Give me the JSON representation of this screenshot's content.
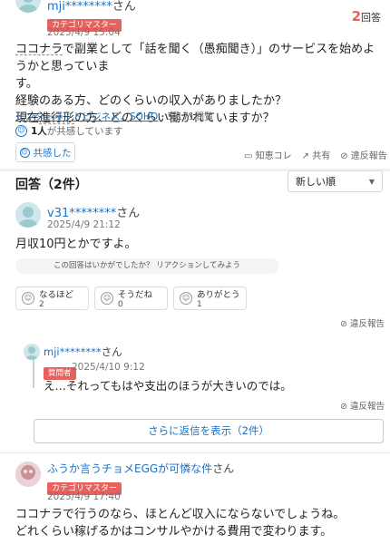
{
  "question": {
    "user": "mji********",
    "san": "さん",
    "badge": "カテゴリマスター",
    "date": "2025/4/9 15:04",
    "answer_count": "2",
    "answer_count_unit": "回答",
    "text_prefix": "ココナラ",
    "text_line1_rest": "で副業として「話を聞く（愚痴聞き）」のサービスを始めようかと思っていま",
    "text_line2": "す。",
    "text_line3": "経験のある方、どのくらいの収入がありましたか？",
    "text_line4_a": "現在",
    "text_line4_u": "進行形",
    "text_line4_b": "の方、どのくらい働かれていますか？",
    "category": "インターネットビジネス、SOHO",
    "views": "・5,171閲覧",
    "empathy_count": "1人",
    "empathy_text": "が共感しています",
    "empathy_button": "共感した",
    "actions": [
      "知恵コレ",
      "共有",
      "違反報告"
    ]
  },
  "answers_header": {
    "title": "回答（2件）",
    "sort_value": "新しい順"
  },
  "answer1": {
    "user": "v31********",
    "san": "さん",
    "date": "2025/4/9 21:12",
    "text": "月収10円とかですよ。",
    "prompt": "この回答はいかがでしたか？ リアクションしてみよう",
    "reactions": [
      {
        "label": "なるほど",
        "count": "2"
      },
      {
        "label": "そうだね",
        "count": "0"
      },
      {
        "label": "ありがとう",
        "count": "1"
      }
    ],
    "report": "違反報告"
  },
  "reply1": {
    "user": "mji********",
    "san": "さん",
    "badge": "質問者",
    "date": "2025/4/10 9:12",
    "text": "え…それってもはや支出のほうが大きいのでは。",
    "report": "違反報告",
    "more_button": "さらに返信を表示（2件）"
  },
  "answer2": {
    "user": "ふうか言うチョメEGGが可憐な件",
    "san": "さん",
    "badge": "カテゴリマスター",
    "date": "2025/4/9 17:40",
    "text_line1": "ココナラで行うのなら、ほとんど収入にならないでしょうね。",
    "text_line2": "どれくらい稼げるかはコンサルやかける費用で変わります。"
  },
  "colors": {
    "link": "#1a73c8",
    "badge": "#e8615e",
    "count_red": "#e8615e"
  }
}
